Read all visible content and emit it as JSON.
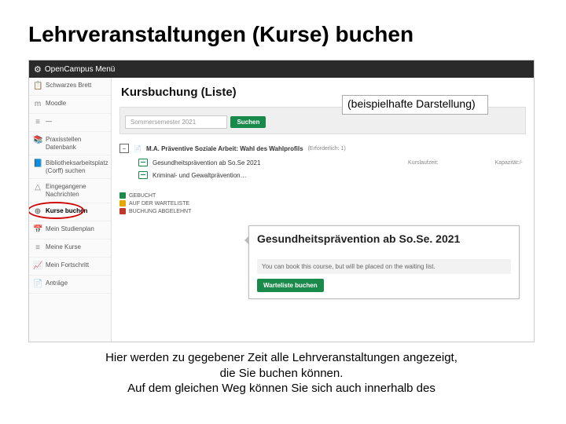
{
  "slide": {
    "title": "Lehrveranstaltungen (Kurse) buchen",
    "callout": "(beispielhafte Darstellung)",
    "footer_l1": "Hier werden zu gegebener Zeit alle Lehrveranstaltungen angezeigt,",
    "footer_l2": "die Sie buchen können.",
    "footer_l3": "Auf dem gleichen Weg können Sie sich auch innerhalb des"
  },
  "topbar": {
    "label": "OpenCampus Menü"
  },
  "sidebar": {
    "items": [
      {
        "icon": "📋",
        "label": "Schwarzes Brett"
      },
      {
        "icon": "m",
        "label": "Moodle"
      },
      {
        "icon": "≡",
        "label": "—"
      },
      {
        "icon": "📚",
        "label": "Praxisstellen Datenbank"
      },
      {
        "icon": "📘",
        "label": "Bibliotheksarbeitsplatz (Corff) suchen"
      },
      {
        "icon": "△",
        "label": "Eingegangene Nachrichten"
      },
      {
        "icon": "⊕",
        "label": "Kurse buchen"
      },
      {
        "icon": "📅",
        "label": "Mein Studienplan"
      },
      {
        "icon": "≡",
        "label": "Meine Kurse"
      },
      {
        "icon": "📈",
        "label": "Mein Fortschritt"
      },
      {
        "icon": "📄",
        "label": "Anträge"
      }
    ]
  },
  "content": {
    "heading": "Kursbuchung (Liste)",
    "semester_placeholder": "Sommersemester 2021",
    "search_label": "Suchen",
    "module_title": "M.A. Präventive Soziale Arbeit: Wahl des Wahlprofils",
    "module_req": "(Erforderlich: 1)",
    "courses": [
      {
        "title": "Gesundheitsprävention ab So.Se 2021",
        "meta_time": "Kurslaufzeit:",
        "meta_cap": "Kapazität:/-"
      },
      {
        "title": "Kriminal- und Gewaltprävention…"
      }
    ]
  },
  "legend": {
    "booked": "GEBUCHT",
    "wait": "AUF DER WARTELISTE",
    "rej": "BUCHUNG ABGELEHNT"
  },
  "popup": {
    "title": "Gesundheitsprävention ab So.Se. 2021",
    "note": "You can book this course, but will be placed on the waiting list.",
    "btn": "Warteliste buchen"
  }
}
